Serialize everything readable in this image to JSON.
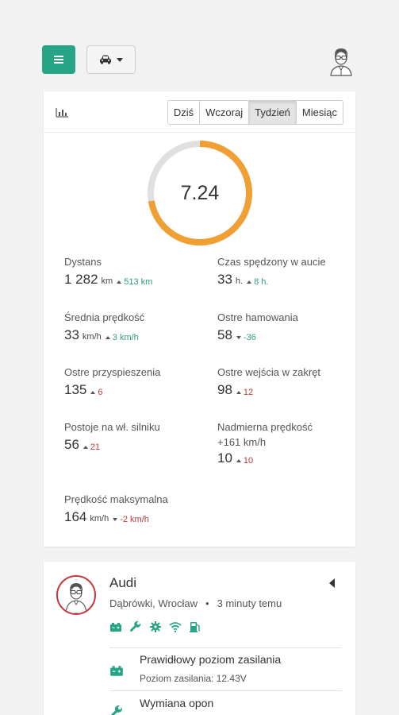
{
  "header": {
    "menu_icon": "hamburger-icon",
    "vehicle_select_icon": "car-icon",
    "user_icon": "user-avatar-icon"
  },
  "stats": {
    "chart_icon": "bar-chart-icon",
    "periods": [
      {
        "label": "Dziś",
        "active": false
      },
      {
        "label": "Wczoraj",
        "active": false
      },
      {
        "label": "Tydzień",
        "active": true
      },
      {
        "label": "Miesiąc",
        "active": false
      }
    ],
    "score": {
      "value": "7.24",
      "fraction": 0.724,
      "color": "#f0a033",
      "track_color": "#e0e0e0"
    },
    "items": {
      "distance": {
        "label": "Dystans",
        "value": "1 282",
        "unit": "km",
        "delta": "513 km",
        "direction": "up",
        "trend": "good"
      },
      "time_in_car": {
        "label": "Czas spędzony w aucie",
        "value": "33",
        "unit": "h.",
        "delta": "8 h.",
        "direction": "up",
        "trend": "good"
      },
      "avg_speed": {
        "label": "Średnia prędkość",
        "value": "33",
        "unit": "km/h",
        "delta": "3 km/h",
        "direction": "up",
        "trend": "good"
      },
      "harsh_braking": {
        "label": "Ostre hamowania",
        "value": "58",
        "unit": "",
        "delta": "-36",
        "direction": "down",
        "trend": "good"
      },
      "harsh_accel": {
        "label": "Ostre przyspieszenia",
        "value": "135",
        "unit": "",
        "delta": "6",
        "direction": "up",
        "trend": "bad"
      },
      "harsh_turns": {
        "label": "Ostre wejścia w zakręt",
        "value": "98",
        "unit": "",
        "delta": "12",
        "direction": "up",
        "trend": "bad"
      },
      "idling": {
        "label": "Postoje na wł. silniku",
        "value": "56",
        "unit": "",
        "delta": "21",
        "direction": "up",
        "trend": "bad"
      },
      "speeding": {
        "label": "Nadmierna prędkość",
        "sub": "+161 km/h",
        "value": "10",
        "unit": "",
        "delta": "10",
        "direction": "up",
        "trend": "bad"
      },
      "max_speed": {
        "label": "Prędkość maksymalna",
        "value": "164",
        "unit": "km/h",
        "delta": "-2 km/h",
        "direction": "down",
        "trend": "bad"
      }
    }
  },
  "vehicle": {
    "name": "Audi",
    "location": "Dąbrówki, Wrocław",
    "separator": "•",
    "time": "3 minuty temu",
    "status_color": "#26a586",
    "status_icons": [
      "battery-icon",
      "wrench-icon",
      "gear-warning-icon",
      "wifi-icon",
      "fuel-icon"
    ],
    "rows": [
      {
        "icon": "battery-icon",
        "title": "Prawidłowy poziom zasilania",
        "sub": "Poziom zasilania: 12.43V"
      },
      {
        "icon": "wrench-icon",
        "title": "Wymiana opon",
        "sub": ""
      }
    ]
  }
}
